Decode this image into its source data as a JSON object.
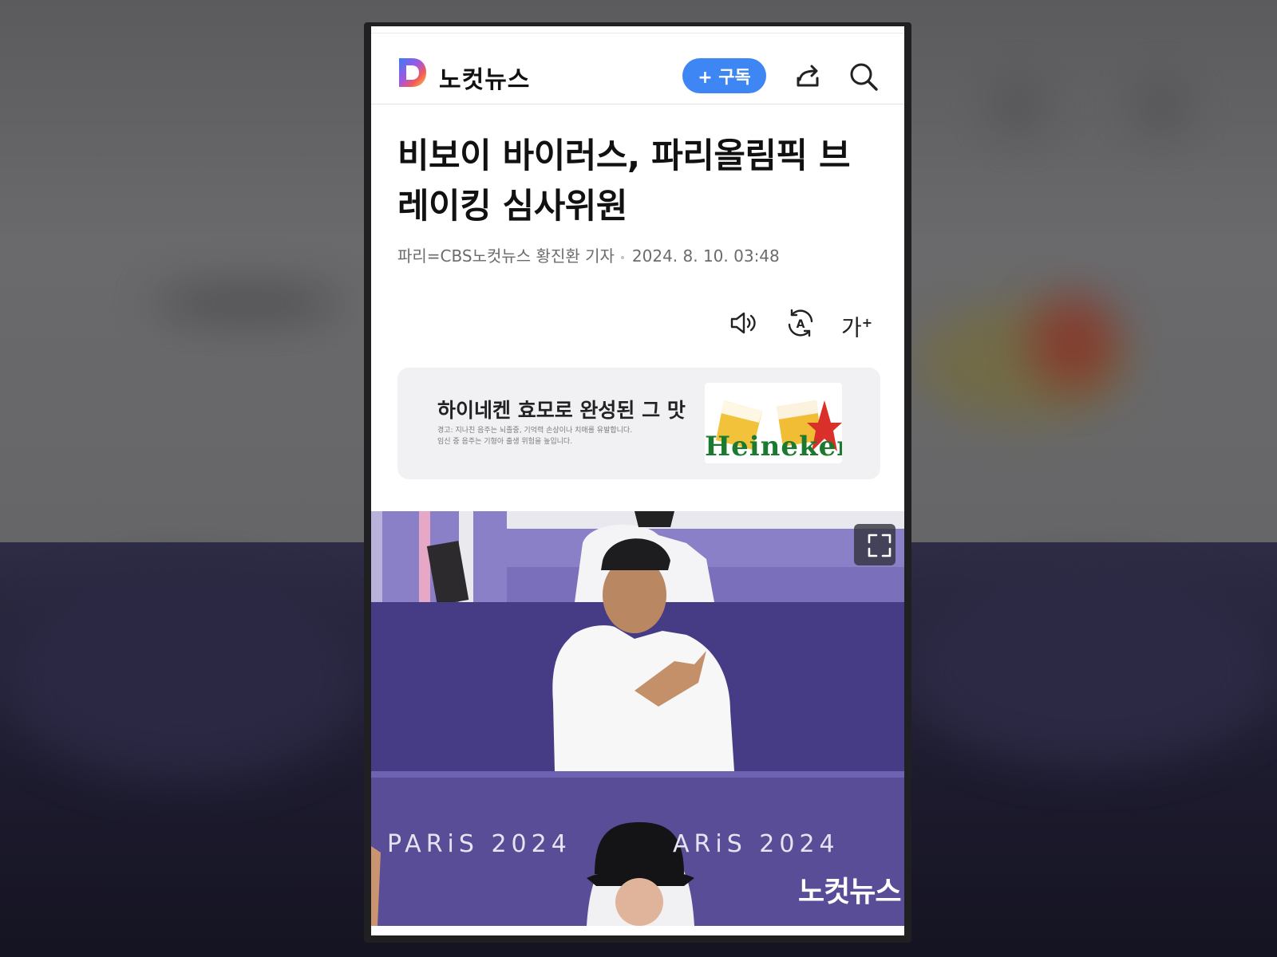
{
  "header": {
    "brand": "노컷뉴스",
    "subscribe_label": "+ 구독"
  },
  "article": {
    "title": "비보이 바이러스, 파리올림픽 브레이킹 심사위원",
    "byline": "파리=CBS노컷뉴스 황진환 기자",
    "date": "2024. 8. 10. 03:48"
  },
  "tools": {
    "font_label": "가",
    "font_plus": "+"
  },
  "ad": {
    "title": "하이네켄 효모로 완성된 그 맛",
    "warning_line1": "경고: 지나친 음주는 뇌졸중, 기억력 손상이나 치매를 유발합니다.",
    "warning_line2": "임신 중 음주는 기형아 출생 위험을 높입니다.",
    "image_brand": "Heineken"
  },
  "photo": {
    "banner_left": "PARiS 2024",
    "banner_right": "ARiS 2024",
    "watermark": "노컷뉴스"
  },
  "colors": {
    "accent": "#3f86f5",
    "banner_purple": "#5a4d97"
  }
}
